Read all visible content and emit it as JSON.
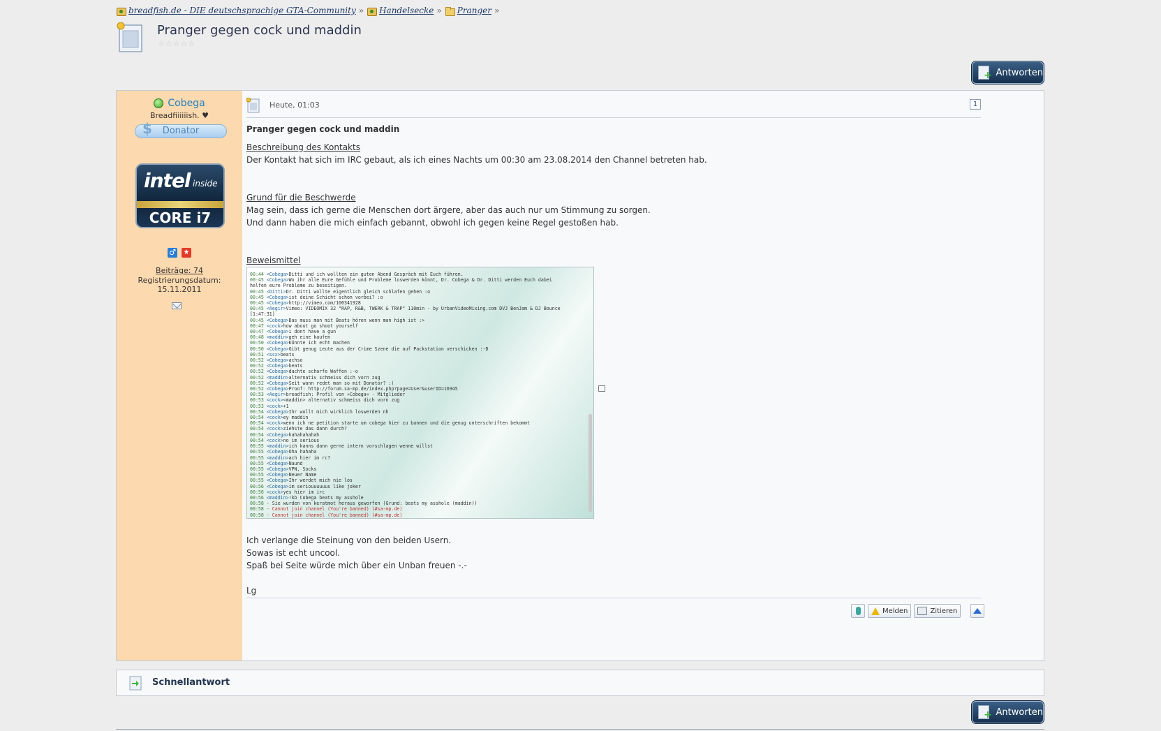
{
  "breadcrumb": {
    "items": [
      {
        "label": "breadfish.de - DIE deutschsprachige GTA-Community",
        "icon": "home-icon"
      },
      {
        "label": "Handelsecke",
        "icon": "board-icon"
      },
      {
        "label": "Pranger",
        "icon": "folder-icon"
      }
    ],
    "separator": "»"
  },
  "thread": {
    "title": "Pranger gegen cock und maddin",
    "rating_stars": 5,
    "rating_value": 0
  },
  "reply_button": {
    "label": "Antworten"
  },
  "post": {
    "author": {
      "name": "Cobega",
      "status": "online",
      "title": "Breadfiiiiiish. ♥",
      "rank": "Donator",
      "avatar_text": {
        "brand": "intel",
        "inside": "inside",
        "model": "CORE i7"
      },
      "posts_label": "Beiträge: 74",
      "reg_label": "Registrierungsdatum:",
      "reg_date": "15.11.2011"
    },
    "date": "Heute, 01:03",
    "number": "1",
    "heading": "Pranger gegen cock und maddin",
    "section1_title": "Beschreibung des Kontakts",
    "section1_text": "Der Kontakt hat sich im IRC gebaut, als ich eines Nachts um 00:30 am 23.08.2014 den Channel betreten hab.",
    "section2_title": "Grund für die Beschwerde",
    "section2_line1": "Mag sein, dass ich gerne die Menschen dort ärgere, aber das auch nur um Stimmung zu sorgen.",
    "section2_line2": "Und dann haben die mich einfach gebannt, obwohl ich gegen keine Regel gestoßen hab.",
    "section3_title": "Beweismittel",
    "irc_log": [
      {
        "t": "00:44",
        "n": "<Cobega>",
        "m": "Ditti und ich wollten ein guten Abend Gespräch mit Euch führen."
      },
      {
        "t": "00:45",
        "n": "<Cobega>",
        "m": "Wo ihr alle Eure Gefühle und Probleme loswerden könnt, Dr. Cobega & Dr. Ditti werden Euch dabei"
      },
      {
        "t": "",
        "n": "",
        "m": "    helfen eure Probleme zu beseitigen."
      },
      {
        "t": "00:45",
        "n": "<Ditti>",
        "m": "Dr. Ditti wollte eigentlich gleich schlafen gehen :o"
      },
      {
        "t": "00:45",
        "n": "<Cobega>",
        "m": "ist deine Schicht schon vorbei? :o"
      },
      {
        "t": "00:45",
        "n": "<Cobega>",
        "m": "http://vimeo.com/100341928"
      },
      {
        "t": "00:45",
        "n": "<Aegir>",
        "m": "Vimeo: VIDEOMIX 32 \"RAP, R&B, TWERK & TRAP\" 110min - by UrbanVideoMixing.com DVJ BenJam & DJ Bounce"
      },
      {
        "t": "",
        "n": "",
        "m": "    [1:47:31]"
      },
      {
        "t": "00:45",
        "n": "<Cobega>",
        "m": "Das muss man mit Beats hören wenn man high ist :>"
      },
      {
        "t": "00:47",
        "n": "<cock>",
        "m": "how about go shoot yourself"
      },
      {
        "t": "00:47",
        "n": "<Cobega>",
        "m": "i dont have a gun"
      },
      {
        "t": "00:48",
        "n": "<maddin>",
        "m": "geh eine kaufen"
      },
      {
        "t": "00:50",
        "n": "<Cobega>",
        "m": "Könnte ich echt machen"
      },
      {
        "t": "00:50",
        "n": "<Cobega>",
        "m": "Gibt genug Leute aus der Crime Szene die auf Packstation verschicken :-D"
      },
      {
        "t": "00:51",
        "n": "<ssx>",
        "m": "beats"
      },
      {
        "t": "00:52",
        "n": "<Cobega>",
        "m": "achso"
      },
      {
        "t": "00:52",
        "n": "<Cobega>",
        "m": "beats"
      },
      {
        "t": "00:52",
        "n": "<Cobega>",
        "m": "dachte scharfe Waffen :-o"
      },
      {
        "t": "00:52",
        "n": "<maddin>",
        "m": "alternativ schmeiss dich vorn zug"
      },
      {
        "t": "00:52",
        "n": "<Cobega>",
        "m": "Seit wann redet man so mit Donator? :("
      },
      {
        "t": "00:52",
        "n": "<Cobega>",
        "m": "Proof: http://forum.sa-mp.de/index.php?page=User&userID=16945"
      },
      {
        "t": "00:53",
        "n": "<Aegir>",
        "m": "breadfish: Profil von »Cobega« - Mitglieder"
      },
      {
        "t": "00:53",
        "n": "<cock>",
        "m": "<maddin> alternativ schmeiss dich vorn zug"
      },
      {
        "t": "00:53",
        "n": "<cock>",
        "m": "+1"
      },
      {
        "t": "00:54",
        "n": "<Cobega>",
        "m": "Ihr wollt mich wirklich loswerden nh"
      },
      {
        "t": "00:54",
        "n": "<cock>",
        "m": "ey maddin"
      },
      {
        "t": "00:54",
        "n": "<cock>",
        "m": "wenn ich ne petition starte um cobega hier zu bannen und die genug unterschriften bekommt"
      },
      {
        "t": "00:54",
        "n": "<cock>",
        "m": "ziehste das dann durch?"
      },
      {
        "t": "00:54",
        "n": "<Cobega>",
        "m": "hahahahahah"
      },
      {
        "t": "00:54",
        "n": "<cock>",
        "m": "no im serious"
      },
      {
        "t": "00:55",
        "n": "<maddin>",
        "m": "ich kanns dann gerne intern vorschlagen wenne willst"
      },
      {
        "t": "00:55",
        "n": "<Cobega>",
        "m": "Oha hahaha"
      },
      {
        "t": "00:55",
        "n": "<maddin>",
        "m": "ach hier im rc?"
      },
      {
        "t": "00:55",
        "n": "<Cobega>",
        "m": "Naund"
      },
      {
        "t": "00:55",
        "n": "<Cobega>",
        "m": "VPN, Socks"
      },
      {
        "t": "00:55",
        "n": "<Cobega>",
        "m": "Neuer Name"
      },
      {
        "t": "00:55",
        "n": "<Cobega>",
        "m": "Ihr werdet mich nie los"
      },
      {
        "t": "00:56",
        "n": "<Cobega>",
        "m": "im seriouuuuuus like joker"
      },
      {
        "t": "00:56",
        "n": "<cock>",
        "m": "yes hier im irc"
      },
      {
        "t": "00:56",
        "n": "<maddin>",
        "m": "!kb Cobega beats my asshole"
      },
      {
        "t": "00:58",
        "n": "",
        "m": "- Sie wurden von keratmot heraus geworfen (Grund: beats my asshole (maddin))"
      },
      {
        "t": "00:58",
        "n": "",
        "m": "- Cannot join channel (You're banned) (#sa-mp.de)",
        "r": true
      },
      {
        "t": "00:58",
        "n": "",
        "m": "- Cannot join channel (You're banned) (#sa-mp.de)",
        "r": true
      }
    ],
    "closing_line1": "Ich verlange die Steinung von den beiden Usern.",
    "closing_line2": "Sowas ist echt uncool.",
    "closing_line3": "Spaß bei Seite würde mich über ein Unban freuen -.-",
    "signoff": "Lg",
    "buttons": {
      "report": "Melden",
      "quote": "Zitieren"
    }
  },
  "quick_reply": {
    "label": "Schnellantwort"
  },
  "colors": {
    "sidebar_bg": "#fcd9ae",
    "accent_link": "#1f7fc4",
    "button_bg": "#16304f"
  }
}
